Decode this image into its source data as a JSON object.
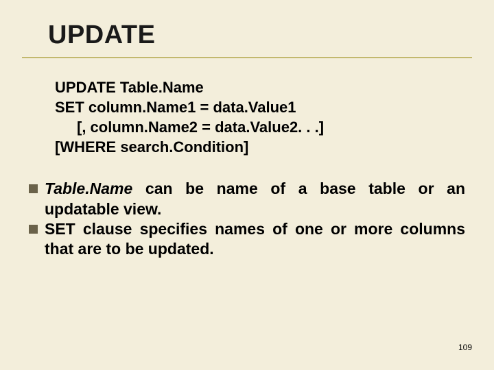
{
  "title": "UPDATE",
  "code": {
    "l1": "UPDATE Table.Name",
    "l2": "SET column.Name1 = data.Value1",
    "l3": "[, column.Name2 = data.Value2. . .]",
    "l4": "[WHERE search.Condition]"
  },
  "bullets": {
    "b1_italic": "Table.Name",
    "b1_rest": " can be name of a base table or an updatable view.",
    "b2": "SET clause specifies names of one or more columns that are to be updated."
  },
  "page_number": "109"
}
